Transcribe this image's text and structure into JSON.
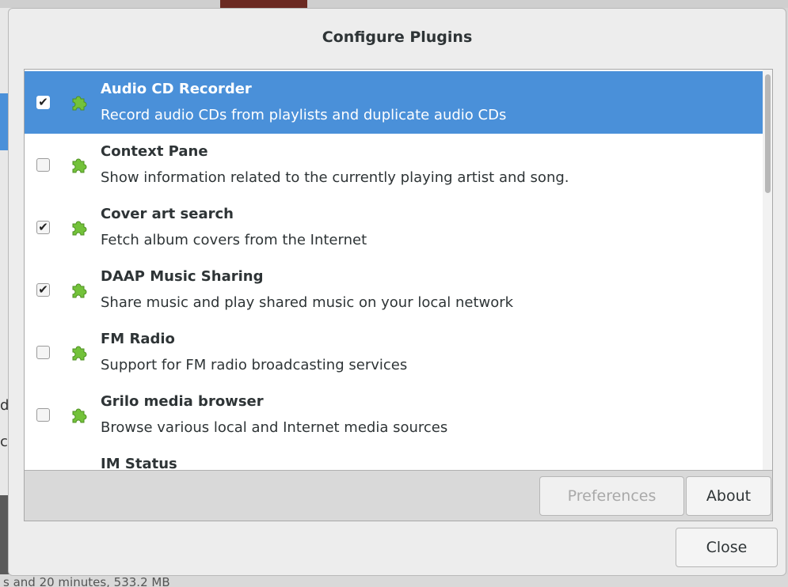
{
  "dialog": {
    "title": "Configure Plugins"
  },
  "plugins": [
    {
      "name": "Audio CD Recorder",
      "description": "Record audio CDs from playlists and duplicate audio CDs",
      "checked": true,
      "selected": true
    },
    {
      "name": "Context Pane",
      "description": "Show information related to the currently playing artist and song.",
      "checked": false,
      "selected": false
    },
    {
      "name": "Cover art search",
      "description": "Fetch album covers from the Internet",
      "checked": true,
      "selected": false
    },
    {
      "name": "DAAP Music Sharing",
      "description": "Share music and play shared music on your local network",
      "checked": true,
      "selected": false
    },
    {
      "name": "FM Radio",
      "description": "Support for FM radio broadcasting services",
      "checked": false,
      "selected": false
    },
    {
      "name": "Grilo media browser",
      "description": "Browse various local and Internet media sources",
      "checked": false,
      "selected": false
    },
    {
      "name": "IM Status",
      "description": "",
      "checked": false,
      "selected": false
    }
  ],
  "buttons": {
    "preferences": "Preferences",
    "about": "About",
    "close": "Close"
  },
  "background": {
    "status_text": "s and 20 minutes, 533.2 MB",
    "left_frag_1": "d",
    "left_frag_2": "c"
  },
  "colors": {
    "selection": "#4a90d9",
    "plugin_icon": "#73c23a"
  },
  "icons": {
    "plugin": "puzzle-piece-icon",
    "check": "checkmark-icon"
  }
}
